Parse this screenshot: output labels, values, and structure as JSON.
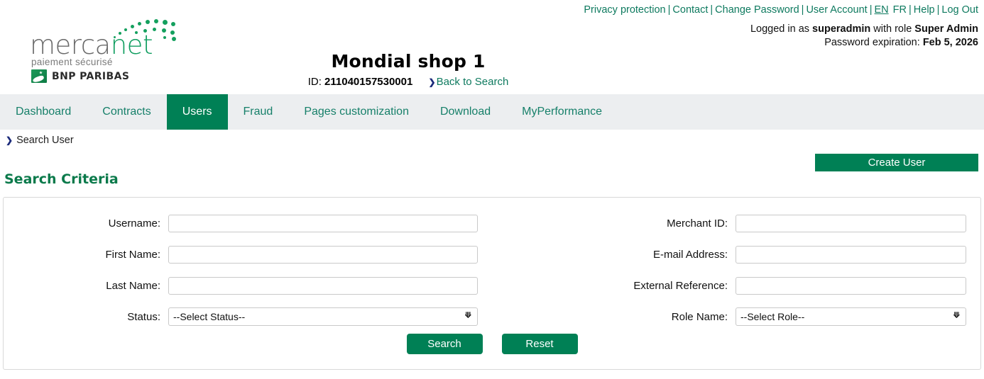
{
  "colors": {
    "brand_green": "#008055",
    "link_green": "#0e7a5f",
    "tabbar_bg": "#eceef0",
    "heading_green": "#0b7a4b",
    "chevron_navy": "#1b2a7a"
  },
  "header": {
    "links": [
      {
        "label": "Privacy protection",
        "active": false
      },
      {
        "label": "Contact",
        "active": false
      },
      {
        "label": "Change Password",
        "active": false
      },
      {
        "label": "User Account",
        "active": false
      },
      {
        "label": "EN",
        "active": true
      },
      {
        "label": "FR",
        "active": false
      },
      {
        "label": "Help",
        "active": false
      },
      {
        "label": "Log Out",
        "active": false
      }
    ],
    "separator": "|",
    "logged_in_prefix": "Logged in as ",
    "logged_in_user": "superadmin",
    "logged_in_mid": " with role ",
    "logged_in_role": "Super Admin",
    "password_expiration_label": "Password expiration: ",
    "password_expiration_value": "Feb 5, 2026"
  },
  "logo": {
    "word_part1": "merca",
    "word_part2": "net",
    "tagline": "paiement sécurisé",
    "bank": "BNP PARIBAS"
  },
  "title": {
    "shop_name": "Mondial shop 1",
    "id_label": "ID: ",
    "id_value": "211040157530001",
    "back_link": "Back to Search",
    "chevron": "❯"
  },
  "tabs": [
    {
      "label": "Dashboard",
      "active": false
    },
    {
      "label": "Contracts",
      "active": false
    },
    {
      "label": "Users",
      "active": true
    },
    {
      "label": "Fraud",
      "active": false
    },
    {
      "label": "Pages customization",
      "active": false
    },
    {
      "label": "Download",
      "active": false
    },
    {
      "label": "MyPerformance",
      "active": false
    }
  ],
  "breadcrumb": {
    "chevron": "❯",
    "label": "Search User"
  },
  "toolbar": {
    "create_user_label": "Create User"
  },
  "section": {
    "heading": "Search Criteria"
  },
  "form": {
    "left": [
      {
        "label": "Username:",
        "type": "text",
        "value": "",
        "placeholder": ""
      },
      {
        "label": "First Name:",
        "type": "text",
        "value": "",
        "placeholder": ""
      },
      {
        "label": "Last Name:",
        "type": "text",
        "value": "",
        "placeholder": ""
      },
      {
        "label": "Status:",
        "type": "select",
        "value": "--Select Status--"
      }
    ],
    "right": [
      {
        "label": "Merchant ID:",
        "type": "text",
        "value": "",
        "placeholder": ""
      },
      {
        "label": "E-mail Address:",
        "type": "text",
        "value": "",
        "placeholder": ""
      },
      {
        "label": "External Reference:",
        "type": "text",
        "value": "",
        "placeholder": ""
      },
      {
        "label": "Role Name:",
        "type": "select",
        "value": "--Select Role--"
      }
    ],
    "buttons": {
      "search_label": "Search",
      "reset_label": "Reset"
    },
    "select_arrow": "⌄"
  }
}
